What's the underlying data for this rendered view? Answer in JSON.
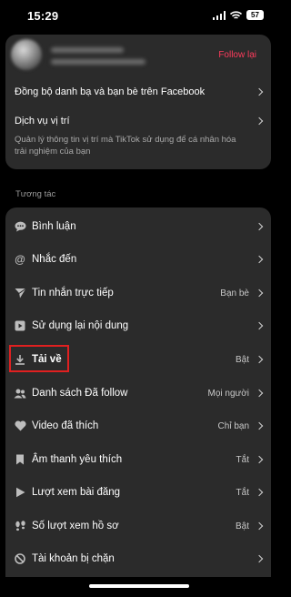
{
  "status_bar": {
    "time": "15:29",
    "battery": "57"
  },
  "account": {
    "follow_back": "Follow lại"
  },
  "top_settings": {
    "sync_facebook": "Đồng bộ danh bạ và bạn bè trên Facebook",
    "location_title": "Dịch vụ vị trí",
    "location_desc_line1": "Quản lý thông tin vị trí mà TikTok sử dụng để cá nhân hóa",
    "location_desc_line2": "trải nghiệm của bạn"
  },
  "section_title": "Tương tác",
  "interactions": [
    {
      "label": "Bình luận",
      "value": "",
      "icon": "comment-icon"
    },
    {
      "label": "Nhắc đến",
      "value": "",
      "icon": "at-sign-icon"
    },
    {
      "label": "Tin nhắn trực tiếp",
      "value": "Bạn bè",
      "icon": "send-icon"
    },
    {
      "label": "Sử dụng lại nội dung",
      "value": "",
      "icon": "reuse-content-icon"
    },
    {
      "label": "Tải về",
      "value": "Bật",
      "icon": "download-icon"
    },
    {
      "label": "Danh sách Đã follow",
      "value": "Mọi người",
      "icon": "people-icon"
    },
    {
      "label": "Video đã thích",
      "value": "Chỉ bạn",
      "icon": "heart-icon"
    },
    {
      "label": "Âm thanh yêu thích",
      "value": "Tắt",
      "icon": "bookmark-icon"
    },
    {
      "label": "Lượt xem bài đăng",
      "value": "Tắt",
      "icon": "play-icon"
    },
    {
      "label": "Số lượt xem hồ sơ",
      "value": "Bật",
      "icon": "footprints-icon"
    },
    {
      "label": "Tài khoản bị chặn",
      "value": "",
      "icon": "blocked-icon"
    }
  ]
}
